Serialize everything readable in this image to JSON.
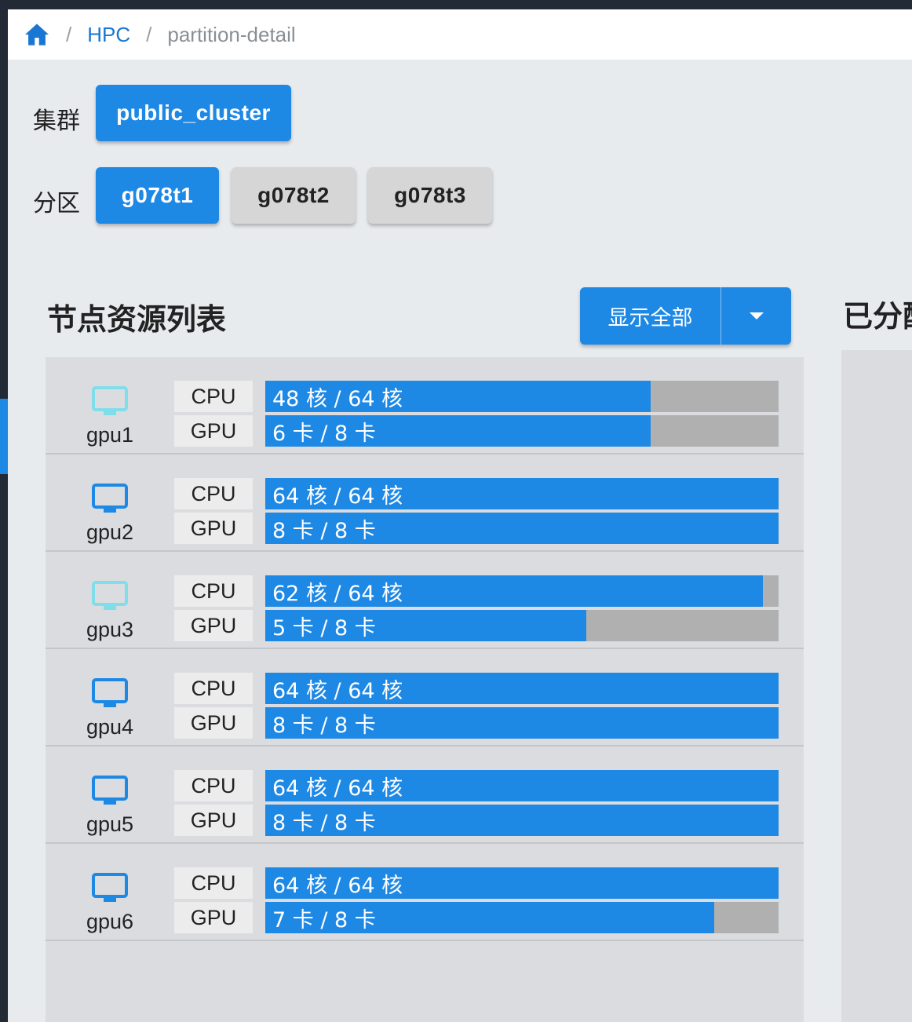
{
  "breadcrumb": {
    "home_icon": "home-icon",
    "sep": "/",
    "link": "HPC",
    "current": "partition-detail"
  },
  "filters": {
    "cluster_label": "集群",
    "clusters": [
      {
        "label": "public_cluster",
        "active": true
      }
    ],
    "partition_label": "分区",
    "partitions": [
      {
        "label": "g078t1",
        "active": true
      },
      {
        "label": "g078t2",
        "active": false
      },
      {
        "label": "g078t3",
        "active": false
      }
    ]
  },
  "section_title": "节点资源列表",
  "right_title": "已分配",
  "show_all_button": {
    "label": "显示全部",
    "caret_icon": "caret-down-icon"
  },
  "colors": {
    "accent": "#1e88e5",
    "unused": "#b0b0b0",
    "icon_full": "#1e88e5",
    "icon_partial": "#80deea"
  },
  "nodes": [
    {
      "name": "gpu1",
      "status": "partial",
      "cpu_label": "CPU",
      "cpu_text": "48 核 / 64 核",
      "cpu_used": 48,
      "cpu_total": 64,
      "gpu_label": "GPU",
      "gpu_text": "6 卡 / 8 卡",
      "gpu_used": 6,
      "gpu_total": 8
    },
    {
      "name": "gpu2",
      "status": "full",
      "cpu_label": "CPU",
      "cpu_text": "64 核 / 64 核",
      "cpu_used": 64,
      "cpu_total": 64,
      "gpu_label": "GPU",
      "gpu_text": "8 卡 / 8 卡",
      "gpu_used": 8,
      "gpu_total": 8
    },
    {
      "name": "gpu3",
      "status": "partial",
      "cpu_label": "CPU",
      "cpu_text": "62 核 / 64 核",
      "cpu_used": 62,
      "cpu_total": 64,
      "gpu_label": "GPU",
      "gpu_text": "5 卡 / 8 卡",
      "gpu_used": 5,
      "gpu_total": 8
    },
    {
      "name": "gpu4",
      "status": "full",
      "cpu_label": "CPU",
      "cpu_text": "64 核 / 64 核",
      "cpu_used": 64,
      "cpu_total": 64,
      "gpu_label": "GPU",
      "gpu_text": "8 卡 / 8 卡",
      "gpu_used": 8,
      "gpu_total": 8
    },
    {
      "name": "gpu5",
      "status": "full",
      "cpu_label": "CPU",
      "cpu_text": "64 核 / 64 核",
      "cpu_used": 64,
      "cpu_total": 64,
      "gpu_label": "GPU",
      "gpu_text": "8 卡 / 8 卡",
      "gpu_used": 8,
      "gpu_total": 8
    },
    {
      "name": "gpu6",
      "status": "full",
      "cpu_label": "CPU",
      "cpu_text": "64 核 / 64 核",
      "cpu_used": 64,
      "cpu_total": 64,
      "gpu_label": "GPU",
      "gpu_text": "7 卡 / 8 卡",
      "gpu_used": 7,
      "gpu_total": 8
    }
  ]
}
